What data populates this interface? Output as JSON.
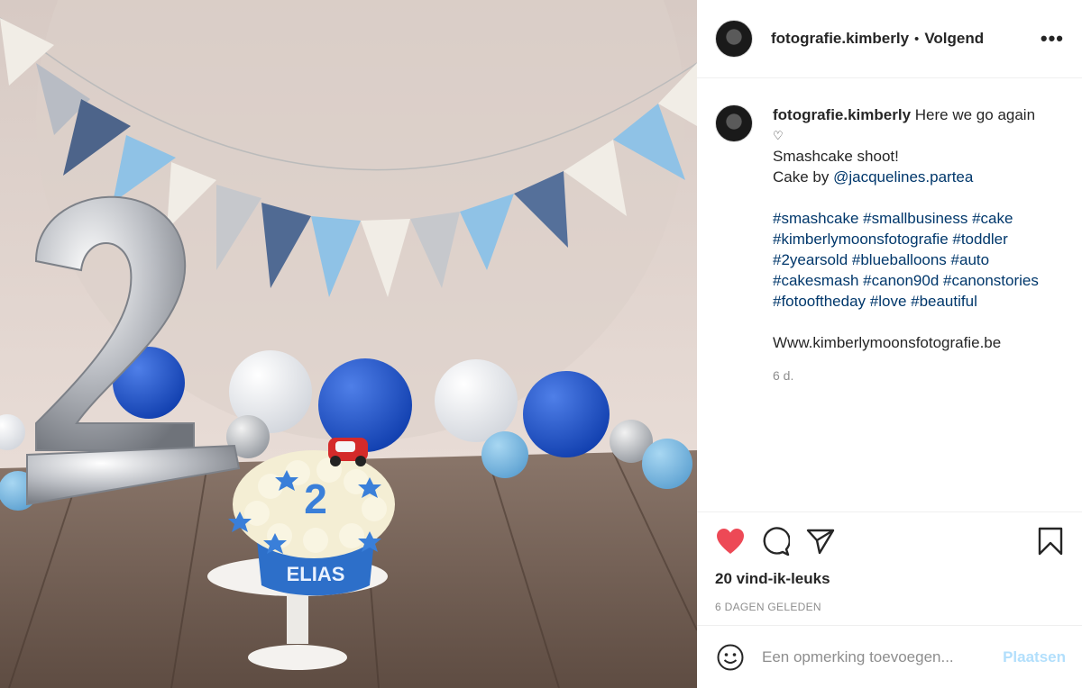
{
  "post": {
    "username": "fotografie.kimberly",
    "follow_dot": "•",
    "follow_label": "Volgend",
    "more_label": "•••"
  },
  "caption": {
    "username": "fotografie.kimberly",
    "first_line": "Here we go again",
    "heart_symbol": "♡",
    "line2": "Smashcake shoot!",
    "line3_prefix": "Cake by ",
    "line3_mention": "@jacquelines.partea",
    "hashtags": [
      "#smashcake #smallbusiness #cake",
      "#kimberlymoonsfotografie #toddler",
      "#2yearsold #blueballoons #auto",
      "#cakesmash #canon90d #canonstories",
      "#fotooftheday #love #beautiful"
    ],
    "website": "Www.kimberlymoonsfotografie.be",
    "age": "6 d."
  },
  "actions": {
    "likes": "20 vind-ik-leuks",
    "timestamp": "6 DAGEN GELEDEN",
    "like_icon": "heart-filled-icon",
    "comment_icon": "comment-icon",
    "share_icon": "paper-plane-icon",
    "save_icon": "bookmark-icon"
  },
  "add_comment": {
    "placeholder": "Een opmerking toevoegen...",
    "post_label": "Plaatsen"
  },
  "photo": {
    "cake_number": "2",
    "cake_name": "ELIAS"
  },
  "colors": {
    "like_red": "#ed4956",
    "link_blue": "#00376b",
    "post_disabled": "#b2dffc"
  }
}
